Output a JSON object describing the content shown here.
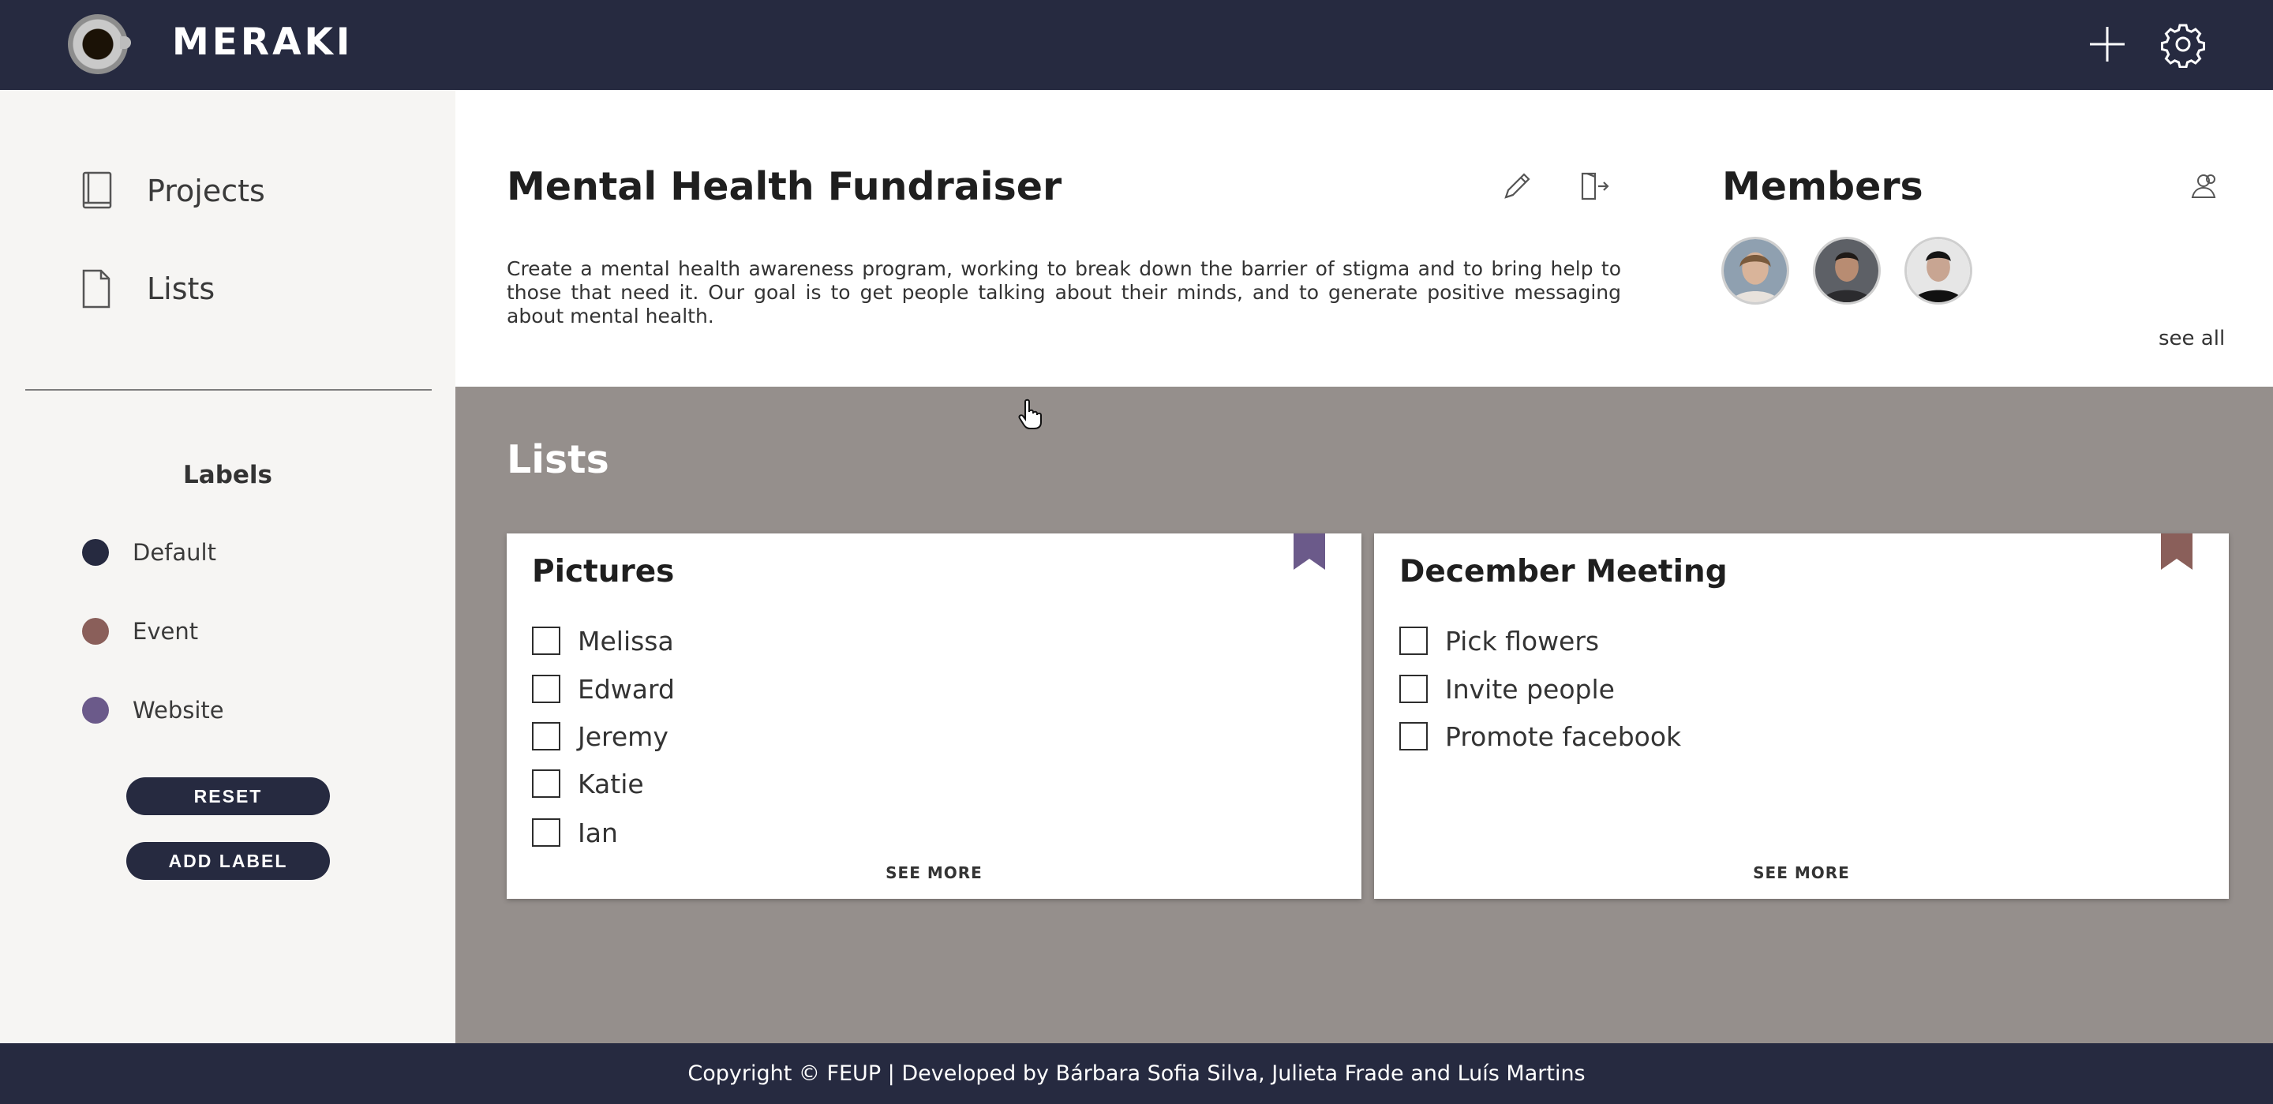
{
  "app": {
    "brand": "MERAKI"
  },
  "topbar": {
    "icons": [
      "plus-icon",
      "gear-icon"
    ]
  },
  "sidebar": {
    "nav": [
      {
        "label": "Projects",
        "icon": "book-icon"
      },
      {
        "label": "Lists",
        "icon": "document-icon"
      }
    ],
    "labels_title": "Labels",
    "labels": [
      {
        "name": "Default",
        "color": "#262a40"
      },
      {
        "name": "Event",
        "color": "#8a5f5a"
      },
      {
        "name": "Website",
        "color": "#6b5a8a"
      }
    ],
    "reset_label": "RESET",
    "add_label": "ADD LABEL"
  },
  "project": {
    "title": "Mental Health Fundraiser",
    "description": "Create a mental health awareness program, working to break down the barrier of stigma and to bring help to those that need it. Our goal is to get people talking about their minds, and to generate positive messaging about mental health.",
    "actions": [
      "edit-pencil-icon",
      "leave-door-icon"
    ]
  },
  "members": {
    "title": "Members",
    "see_all": "see all",
    "avatars": [
      "member-avatar-1",
      "member-avatar-2",
      "member-avatar-3"
    ]
  },
  "lists": {
    "title": "Lists",
    "cards": [
      {
        "title": "Pictures",
        "bookmark_color": "#6b5a8a",
        "items": [
          "Melissa",
          "Edward",
          "Jeremy",
          "Katie",
          "Ian"
        ],
        "see_more": "SEE MORE"
      },
      {
        "title": "December Meeting",
        "bookmark_color": "#8a5f5a",
        "items": [
          "Pick flowers",
          "Invite people",
          "Promote facebook"
        ],
        "see_more": "SEE MORE"
      }
    ]
  },
  "footer": {
    "text": "Copyright © FEUP | Developed by Bárbara Sofia Silva, Julieta Frade and Luís Martins"
  }
}
